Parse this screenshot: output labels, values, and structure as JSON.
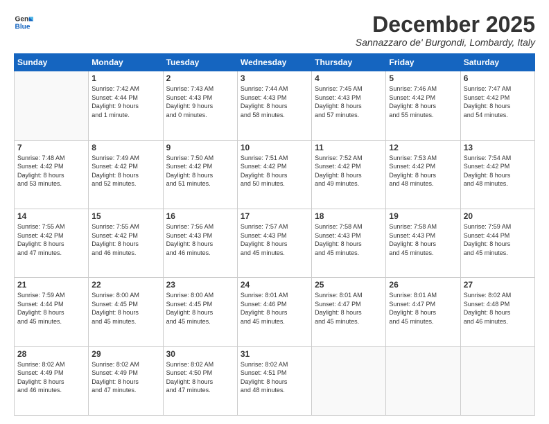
{
  "logo": {
    "line1": "General",
    "line2": "Blue"
  },
  "title": "December 2025",
  "subtitle": "Sannazzaro de' Burgondi, Lombardy, Italy",
  "headers": [
    "Sunday",
    "Monday",
    "Tuesday",
    "Wednesday",
    "Thursday",
    "Friday",
    "Saturday"
  ],
  "weeks": [
    [
      {
        "day": "",
        "info": ""
      },
      {
        "day": "1",
        "info": "Sunrise: 7:42 AM\nSunset: 4:44 PM\nDaylight: 9 hours\nand 1 minute."
      },
      {
        "day": "2",
        "info": "Sunrise: 7:43 AM\nSunset: 4:43 PM\nDaylight: 9 hours\nand 0 minutes."
      },
      {
        "day": "3",
        "info": "Sunrise: 7:44 AM\nSunset: 4:43 PM\nDaylight: 8 hours\nand 58 minutes."
      },
      {
        "day": "4",
        "info": "Sunrise: 7:45 AM\nSunset: 4:43 PM\nDaylight: 8 hours\nand 57 minutes."
      },
      {
        "day": "5",
        "info": "Sunrise: 7:46 AM\nSunset: 4:42 PM\nDaylight: 8 hours\nand 55 minutes."
      },
      {
        "day": "6",
        "info": "Sunrise: 7:47 AM\nSunset: 4:42 PM\nDaylight: 8 hours\nand 54 minutes."
      }
    ],
    [
      {
        "day": "7",
        "info": "Sunrise: 7:48 AM\nSunset: 4:42 PM\nDaylight: 8 hours\nand 53 minutes."
      },
      {
        "day": "8",
        "info": "Sunrise: 7:49 AM\nSunset: 4:42 PM\nDaylight: 8 hours\nand 52 minutes."
      },
      {
        "day": "9",
        "info": "Sunrise: 7:50 AM\nSunset: 4:42 PM\nDaylight: 8 hours\nand 51 minutes."
      },
      {
        "day": "10",
        "info": "Sunrise: 7:51 AM\nSunset: 4:42 PM\nDaylight: 8 hours\nand 50 minutes."
      },
      {
        "day": "11",
        "info": "Sunrise: 7:52 AM\nSunset: 4:42 PM\nDaylight: 8 hours\nand 49 minutes."
      },
      {
        "day": "12",
        "info": "Sunrise: 7:53 AM\nSunset: 4:42 PM\nDaylight: 8 hours\nand 48 minutes."
      },
      {
        "day": "13",
        "info": "Sunrise: 7:54 AM\nSunset: 4:42 PM\nDaylight: 8 hours\nand 48 minutes."
      }
    ],
    [
      {
        "day": "14",
        "info": "Sunrise: 7:55 AM\nSunset: 4:42 PM\nDaylight: 8 hours\nand 47 minutes."
      },
      {
        "day": "15",
        "info": "Sunrise: 7:55 AM\nSunset: 4:42 PM\nDaylight: 8 hours\nand 46 minutes."
      },
      {
        "day": "16",
        "info": "Sunrise: 7:56 AM\nSunset: 4:43 PM\nDaylight: 8 hours\nand 46 minutes."
      },
      {
        "day": "17",
        "info": "Sunrise: 7:57 AM\nSunset: 4:43 PM\nDaylight: 8 hours\nand 45 minutes."
      },
      {
        "day": "18",
        "info": "Sunrise: 7:58 AM\nSunset: 4:43 PM\nDaylight: 8 hours\nand 45 minutes."
      },
      {
        "day": "19",
        "info": "Sunrise: 7:58 AM\nSunset: 4:43 PM\nDaylight: 8 hours\nand 45 minutes."
      },
      {
        "day": "20",
        "info": "Sunrise: 7:59 AM\nSunset: 4:44 PM\nDaylight: 8 hours\nand 45 minutes."
      }
    ],
    [
      {
        "day": "21",
        "info": "Sunrise: 7:59 AM\nSunset: 4:44 PM\nDaylight: 8 hours\nand 45 minutes."
      },
      {
        "day": "22",
        "info": "Sunrise: 8:00 AM\nSunset: 4:45 PM\nDaylight: 8 hours\nand 45 minutes."
      },
      {
        "day": "23",
        "info": "Sunrise: 8:00 AM\nSunset: 4:45 PM\nDaylight: 8 hours\nand 45 minutes."
      },
      {
        "day": "24",
        "info": "Sunrise: 8:01 AM\nSunset: 4:46 PM\nDaylight: 8 hours\nand 45 minutes."
      },
      {
        "day": "25",
        "info": "Sunrise: 8:01 AM\nSunset: 4:47 PM\nDaylight: 8 hours\nand 45 minutes."
      },
      {
        "day": "26",
        "info": "Sunrise: 8:01 AM\nSunset: 4:47 PM\nDaylight: 8 hours\nand 45 minutes."
      },
      {
        "day": "27",
        "info": "Sunrise: 8:02 AM\nSunset: 4:48 PM\nDaylight: 8 hours\nand 46 minutes."
      }
    ],
    [
      {
        "day": "28",
        "info": "Sunrise: 8:02 AM\nSunset: 4:49 PM\nDaylight: 8 hours\nand 46 minutes."
      },
      {
        "day": "29",
        "info": "Sunrise: 8:02 AM\nSunset: 4:49 PM\nDaylight: 8 hours\nand 47 minutes."
      },
      {
        "day": "30",
        "info": "Sunrise: 8:02 AM\nSunset: 4:50 PM\nDaylight: 8 hours\nand 47 minutes."
      },
      {
        "day": "31",
        "info": "Sunrise: 8:02 AM\nSunset: 4:51 PM\nDaylight: 8 hours\nand 48 minutes."
      },
      {
        "day": "",
        "info": ""
      },
      {
        "day": "",
        "info": ""
      },
      {
        "day": "",
        "info": ""
      }
    ]
  ]
}
